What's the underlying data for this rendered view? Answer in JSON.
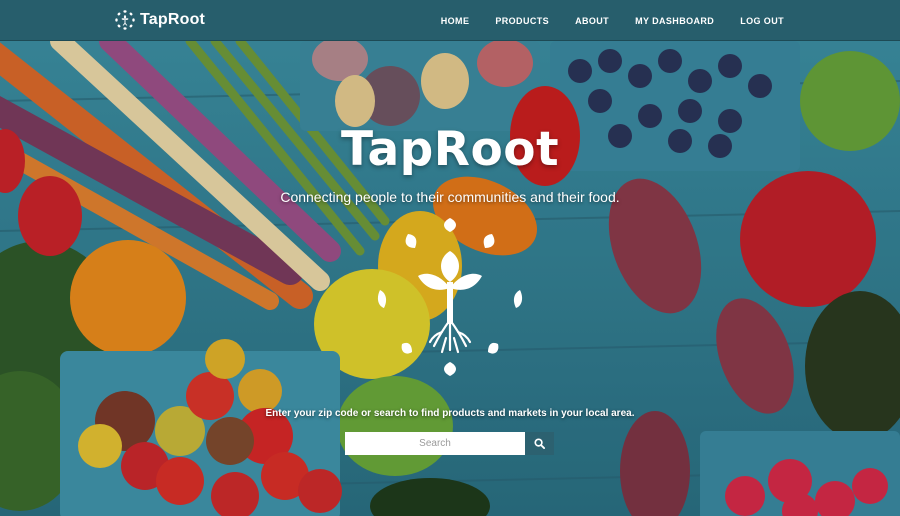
{
  "brand": {
    "name": "TapRoot",
    "logo_icon": "taproot-logo-icon"
  },
  "nav": {
    "items": [
      {
        "label": "HOME"
      },
      {
        "label": "PRODUCTS"
      },
      {
        "label": "ABOUT"
      },
      {
        "label": "MY DASHBOARD"
      },
      {
        "label": "LOG OUT"
      }
    ]
  },
  "hero": {
    "title": "TapRoot",
    "subtitle": "Connecting people to their communities and their food.",
    "emblem_icon": "sprout-with-roots-icon",
    "background": "fresh-produce-on-wooden-table"
  },
  "search": {
    "prompt": "Enter your zip code or search to find products and markets in your local area.",
    "placeholder": "Search",
    "button_icon": "search-icon"
  },
  "colors": {
    "navbar": "#275e6c",
    "search_button": "#2c6170",
    "text": "#ffffff"
  }
}
